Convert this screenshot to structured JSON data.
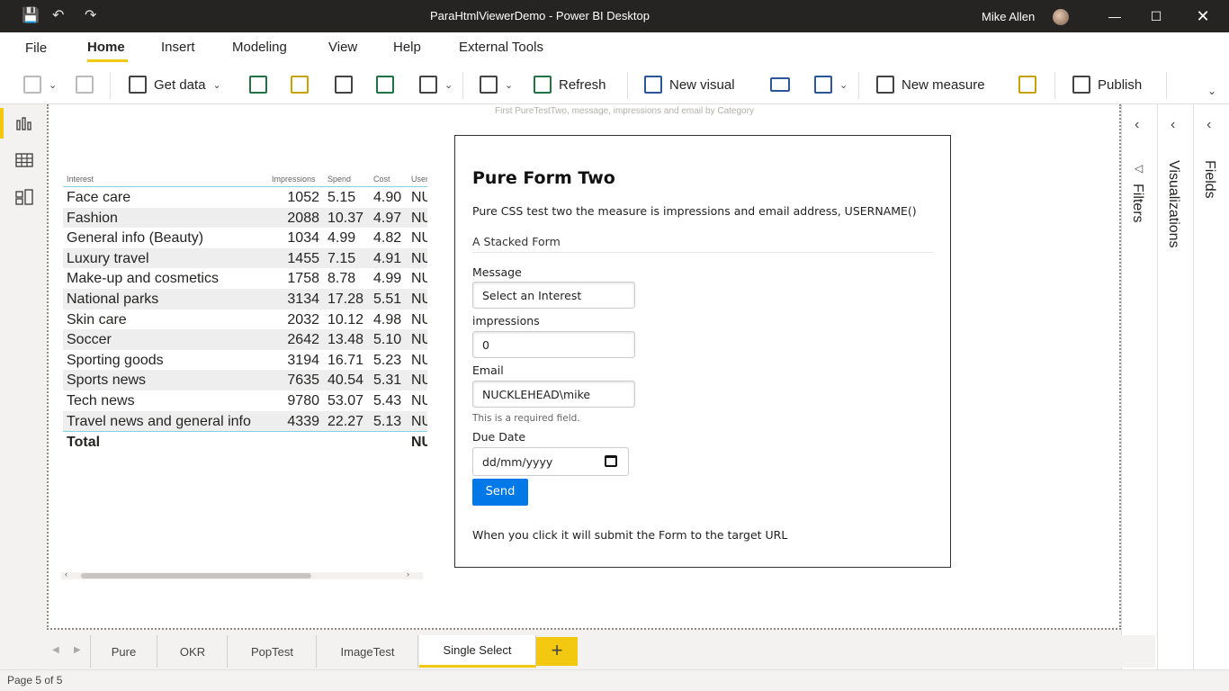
{
  "window": {
    "title": "ParaHtmlViewerDemo - Power BI Desktop",
    "user": "Mike Allen"
  },
  "menu": {
    "tabs": [
      {
        "label": "File"
      },
      {
        "label": "Home"
      },
      {
        "label": "Insert"
      },
      {
        "label": "Modeling"
      },
      {
        "label": "View"
      },
      {
        "label": "Help"
      },
      {
        "label": "External Tools"
      }
    ],
    "active": "Home"
  },
  "ribbon": {
    "get_data": "Get data",
    "refresh": "Refresh",
    "new_visual": "New visual",
    "new_measure": "New measure",
    "publish": "Publish"
  },
  "canvas": {
    "caption": "First PureTestTwo, message, impressions and email by Category"
  },
  "table": {
    "headers": [
      "Interest",
      "Impressions",
      "Spend",
      "Cost",
      "User"
    ],
    "rows": [
      [
        "Face care",
        "1052",
        "5.15",
        "4.90",
        "NU"
      ],
      [
        "Fashion",
        "2088",
        "10.37",
        "4.97",
        "NU"
      ],
      [
        "General info (Beauty)",
        "1034",
        "4.99",
        "4.82",
        "NU"
      ],
      [
        "Luxury travel",
        "1455",
        "7.15",
        "4.91",
        "NU"
      ],
      [
        "Make-up and cosmetics",
        "1758",
        "8.78",
        "4.99",
        "NU"
      ],
      [
        "National parks",
        "3134",
        "17.28",
        "5.51",
        "NU"
      ],
      [
        "Skin care",
        "2032",
        "10.12",
        "4.98",
        "NU"
      ],
      [
        "Soccer",
        "2642",
        "13.48",
        "5.10",
        "NU"
      ],
      [
        "Sporting goods",
        "3194",
        "16.71",
        "5.23",
        "NU"
      ],
      [
        "Sports news",
        "7635",
        "40.54",
        "5.31",
        "NU"
      ],
      [
        "Tech news",
        "9780",
        "53.07",
        "5.43",
        "NU"
      ],
      [
        "Travel news and general info",
        "4339",
        "22.27",
        "5.13",
        "NU"
      ]
    ],
    "total_label": "Total",
    "total_user": "NU"
  },
  "form": {
    "title": "Pure Form Two",
    "description": "Pure CSS test two the measure is impressions and email address, USERNAME()",
    "legend": "A Stacked Form",
    "message_label": "Message",
    "message_value": "Select an Interest",
    "impressions_label": "impressions",
    "impressions_value": "0",
    "email_label": "Email",
    "email_value": "NUCKLEHEAD\\mike",
    "email_help": "This is a required field.",
    "due_label": "Due Date",
    "due_placeholder": "dd/mm/yyyy",
    "send_label": "Send",
    "footer": "When you click it will submit the Form to the target URL"
  },
  "panes": {
    "filters": "Filters",
    "visualizations": "Visualizations",
    "fields": "Fields"
  },
  "pages": {
    "tabs": [
      "Pure",
      "OKR",
      "PopTest",
      "ImageTest",
      "Single Select"
    ],
    "active": "Single Select",
    "add_label": "+"
  },
  "status": {
    "page": "Page 5 of 5"
  }
}
